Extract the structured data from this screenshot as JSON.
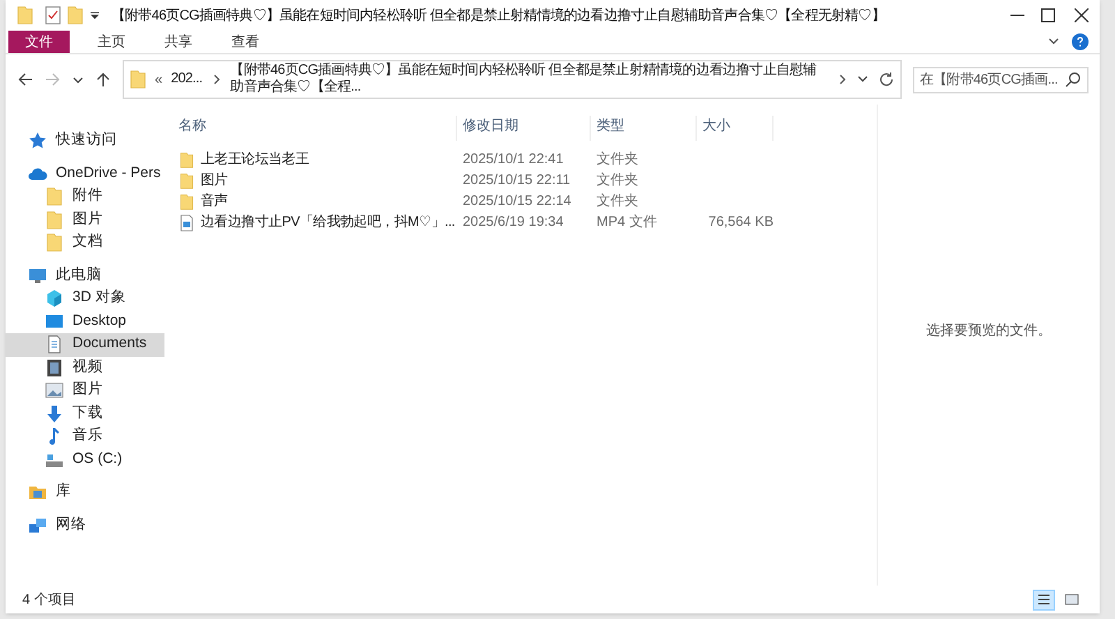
{
  "window": {
    "title": "【附带46页CG插画特典♡】虽能在短时间内轻松聆听 但全都是禁止射精情境的边看边撸寸止自慰辅助音声合集♡【全程无射精♡】"
  },
  "ribbon_tabs": [
    {
      "label": "文件",
      "selected": true
    },
    {
      "label": "主页",
      "selected": false
    },
    {
      "label": "共享",
      "selected": false
    },
    {
      "label": "查看",
      "selected": false
    }
  ],
  "address": {
    "overflow": "«",
    "crumbs": [
      "202...",
      "【附带46页CG插画特典♡】虽能在短时间内轻松聆听 但全都是禁止射精情境的边看边撸寸止自慰辅助音声合集♡【全程..."
    ]
  },
  "search": {
    "placeholder": "在【附带46页CG插画..."
  },
  "sidebar": [
    {
      "label": "快速访问",
      "selected": false
    },
    {
      "label": "OneDrive - Pers",
      "selected": false,
      "children": [
        {
          "label": "附件",
          "selected": false
        },
        {
          "label": "图片",
          "selected": false
        },
        {
          "label": "文档",
          "selected": false
        }
      ]
    },
    {
      "label": "此电脑",
      "selected": false,
      "children": [
        {
          "label": "3D 对象",
          "selected": false
        },
        {
          "label": "Desktop",
          "selected": false
        },
        {
          "label": "Documents",
          "selected": true
        },
        {
          "label": "视频",
          "selected": false
        },
        {
          "label": "图片",
          "selected": false
        },
        {
          "label": "下载",
          "selected": false
        },
        {
          "label": "音乐",
          "selected": false
        },
        {
          "label": "OS (C:)",
          "selected": false
        }
      ]
    },
    {
      "label": "库",
      "selected": false
    },
    {
      "label": "网络",
      "selected": false
    }
  ],
  "table": {
    "columns": [
      "名称",
      "修改日期",
      "类型",
      "大小"
    ],
    "rows": [
      {
        "kind": "folder",
        "name": "上老王论坛当老王",
        "modified": "2025/10/1 22:41",
        "type": "文件夹"
      },
      {
        "kind": "folder",
        "name": "图片",
        "modified": "2025/10/15 22:11",
        "type": "文件夹"
      },
      {
        "kind": "folder",
        "name": "音声",
        "modified": "2025/10/15 22:14",
        "type": "文件夹"
      },
      {
        "kind": "video",
        "name": "边看边撸寸止PV「给我勃起吧，抖M♡」...",
        "modified": "2025/6/19 19:34",
        "type": "MP4 文件",
        "size": "76,564 KB"
      }
    ]
  },
  "preview": {
    "message": "选择要预览的文件。"
  },
  "status_bar": {
    "count": "4 个项目",
    "views": [
      {
        "kind": "details",
        "selected": true
      },
      {
        "kind": "thumbnails",
        "selected": false
      }
    ]
  }
}
